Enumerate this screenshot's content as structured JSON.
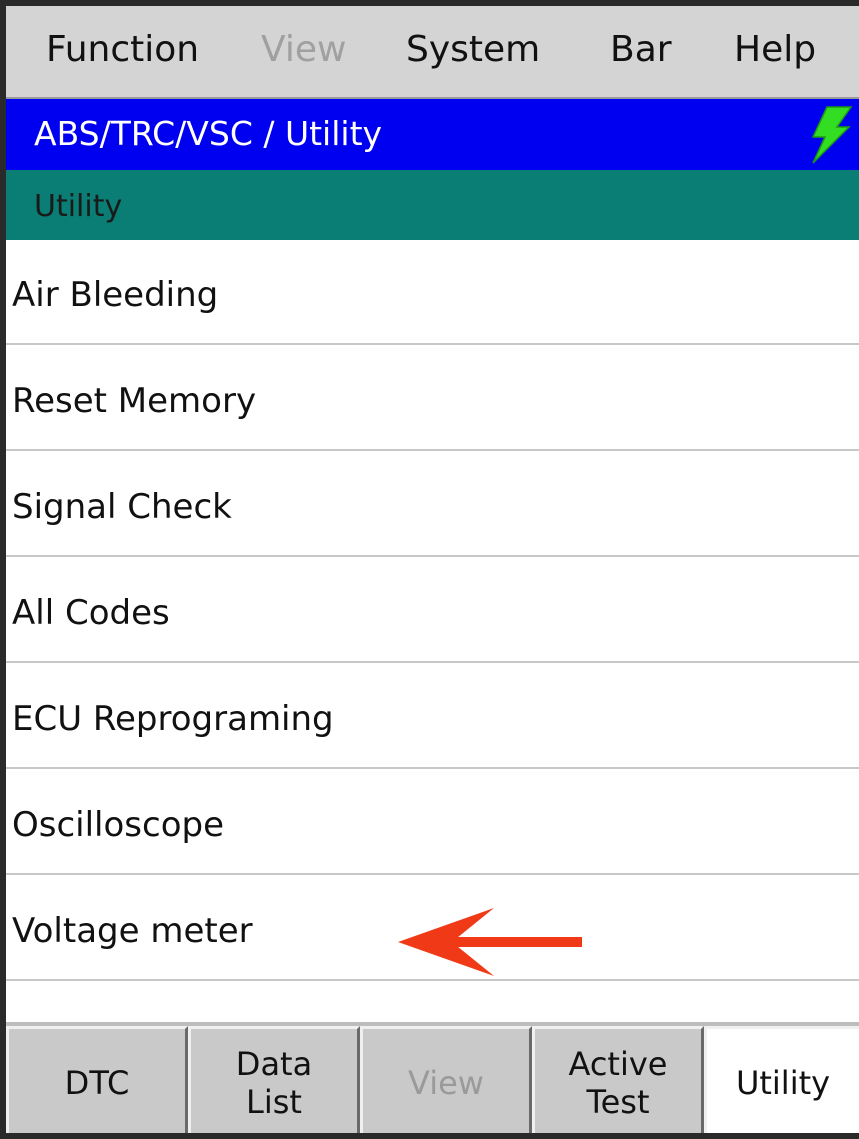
{
  "menu": {
    "function": "Function",
    "view": "View",
    "system": "System",
    "bar": "Bar",
    "help": "Help"
  },
  "title": "ABS/TRC/VSC / Utility",
  "section": "Utility",
  "items": [
    "Air Bleeding",
    "Reset Memory",
    "Signal Check",
    "All Codes",
    "ECU Reprograming",
    "Oscilloscope",
    "Voltage meter"
  ],
  "tabs": {
    "dtc": "DTC",
    "data_list": "Data\nList",
    "view": "View",
    "active_test": "Active\nTest",
    "utility": "Utility"
  },
  "colors": {
    "title_bar": "#0000f0",
    "section_header": "#0a7d74",
    "bolt_icon": "#33dd22",
    "arrow": "#f03a17"
  }
}
